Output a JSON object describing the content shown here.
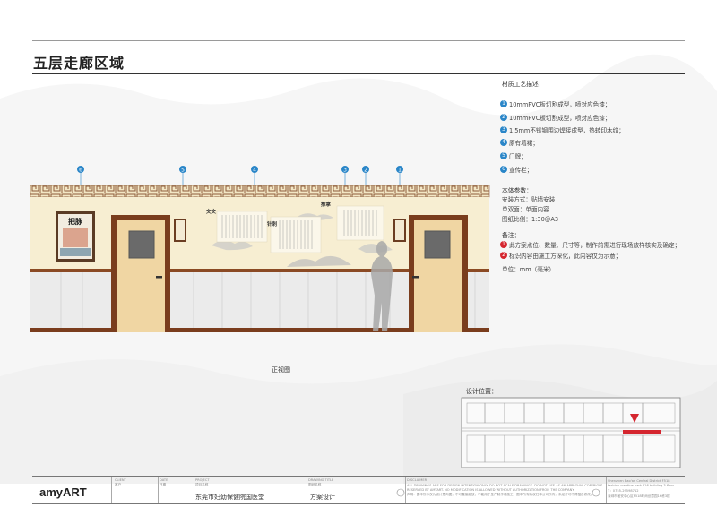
{
  "page": {
    "title": "五层走廊区域",
    "caption": "正视图"
  },
  "materials": {
    "heading": "材质工艺描述：",
    "items": [
      {
        "n": "1",
        "text": "10mmPVC板切割成型，喷对应色漆；"
      },
      {
        "n": "2",
        "text": "10mmPVC板切割成型，喷对应色漆；"
      },
      {
        "n": "3",
        "text": "1.5mm不锈钢围边焊接成型，热转印木纹；"
      },
      {
        "n": "4",
        "text": "原有墙裙；"
      },
      {
        "n": "5",
        "text": "门牌；"
      },
      {
        "n": "6",
        "text": "宣传栏；"
      }
    ]
  },
  "params": {
    "heading": "本体参数：",
    "lines": [
      "安装方式：贴墙安装",
      "单双面：单面内容",
      "图纸比例：1:30@A3"
    ]
  },
  "notes": {
    "heading": "备注：",
    "items": [
      {
        "n": "1",
        "text": "此方案点位、数量、尺寸等，制作前需进行现场放样核实及确定；"
      },
      {
        "n": "2",
        "text": "标识内容由施工方深化，此内容仅为示意；"
      }
    ],
    "unit": "单位：mm（毫米）"
  },
  "callouts": [
    "6",
    "5",
    "4",
    "3",
    "2",
    "1"
  ],
  "artwork_text": {
    "poster_title": "把脉",
    "panel_a": "文文",
    "panel_b": "针刺",
    "panel_c": "推拿"
  },
  "location": {
    "label": "设计位置："
  },
  "title_block": {
    "brand": "amyART",
    "client_label": "CLIENT",
    "client_sub": "客户",
    "date_label": "DATE",
    "date_sub": "日期",
    "project_label": "PROJECT",
    "project_sub": "项目名称",
    "project_name": "东莞市妇幼保健院国医堂",
    "drawing_label": "DRAWING TITLE",
    "drawing_sub": "图纸名称",
    "drawing_name": "方案设计",
    "disclaimer_label": "DISCLAIMER",
    "disclaimer_1": "ALL DRAWINGS ARE FOR DESIGN INTENTION ONLY. DO NOT SCALE DRAWINGS. DO NOT USE AS AN APPROVAL COPYRIGHT OF THIS DRAWING",
    "disclaimer_2": "RESERVED BY AMYART. NO MODIFICATION IS ALLOWED WITHOUT AUTHORIZATION FROM THE COMPANY.",
    "disclaimer_3": "声明：图中所示仅为设计意向图，不可直接缩放，不能用于生产制作或施工；图中所有版权归本公司所有，未经许可不得擅自修改。",
    "address_1": "Shenzhen Bao'an Central District F518",
    "address_2": "fashion creative park F16 building 3 floor",
    "address_3": "T：0755-29598712",
    "address_4": "深圳市宝安中心区F518时尚创意园16栋3楼"
  },
  "colors": {
    "accent_blue": "#2a86c8",
    "accent_red": "#d5262f",
    "wall_cream": "#f7eed2",
    "wainscot": "#ebebeb",
    "skirting": "#7a3d1d",
    "door_wood": "#f0d6a3"
  }
}
